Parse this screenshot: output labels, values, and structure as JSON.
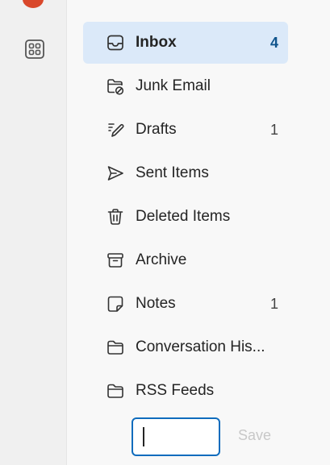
{
  "folders": [
    {
      "label": "Inbox",
      "count": "4",
      "icon": "inbox-icon",
      "selected": true
    },
    {
      "label": "Junk Email",
      "count": "",
      "icon": "junk-folder-icon"
    },
    {
      "label": "Drafts",
      "count": "1",
      "icon": "drafts-pencil-icon"
    },
    {
      "label": "Sent Items",
      "count": "",
      "icon": "send-icon"
    },
    {
      "label": "Deleted Items",
      "count": "",
      "icon": "trash-icon"
    },
    {
      "label": "Archive",
      "count": "",
      "icon": "archive-icon"
    },
    {
      "label": "Notes",
      "count": "1",
      "icon": "note-icon"
    },
    {
      "label": "Conversation His...",
      "count": "",
      "icon": "folder-icon"
    },
    {
      "label": "RSS Feeds",
      "count": "",
      "icon": "folder-icon"
    }
  ],
  "new_folder": {
    "value": "",
    "save_label": "Save"
  },
  "rail": {
    "apps_icon": "apps-grid-icon"
  },
  "colors": {
    "selected_bg": "#dbe9f9",
    "accent": "#0f6cbd",
    "notification_dot": "#d9482b"
  }
}
